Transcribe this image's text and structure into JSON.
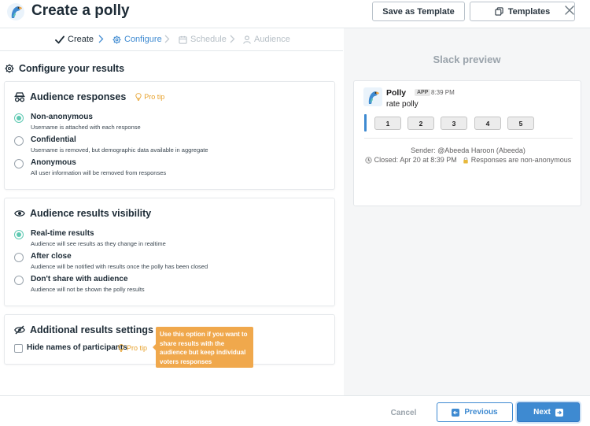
{
  "header": {
    "title": "Create a polly",
    "save_template_label": "Save as Template",
    "templates_label": "Templates"
  },
  "steps": [
    {
      "label": "Create",
      "state": "done"
    },
    {
      "label": "Configure",
      "state": "active"
    },
    {
      "label": "Schedule",
      "state": "pending"
    },
    {
      "label": "Audience",
      "state": "pending"
    }
  ],
  "main": {
    "heading": "Configure your results",
    "audience_responses": {
      "title": "Audience responses",
      "pro_tip": "Pro tip",
      "options": [
        {
          "label": "Non-anonymous",
          "desc": "Username is attached with each response",
          "checked": true
        },
        {
          "label": "Confidential",
          "desc": "Username is removed, but demographic data available in aggregate",
          "checked": false
        },
        {
          "label": "Anonymous",
          "desc": "All user information will be removed from responses",
          "checked": false
        }
      ]
    },
    "results_visibility": {
      "title": "Audience results visibility",
      "options": [
        {
          "label": "Real-time results",
          "desc": "Audience will see results as they change in realtime",
          "checked": true
        },
        {
          "label": "After close",
          "desc": "Audience will be notified with results once the polly has been closed",
          "checked": false
        },
        {
          "label": "Don't share with audience",
          "desc": "Audience will not be shown the polly results",
          "checked": false
        }
      ]
    },
    "additional": {
      "title": "Additional results settings",
      "hide_names_label": "Hide names of participants",
      "pro_tip": "Pro tip",
      "tooltip": "Use this option if you want to share results with the audience but keep individual voters responses anonymous."
    }
  },
  "preview": {
    "title": "Slack preview",
    "bot_name": "Polly",
    "app_badge": "APP",
    "time": "8:39 PM",
    "message": "rate polly",
    "vote_buttons": [
      "1",
      "2",
      "3",
      "4",
      "5"
    ],
    "sender": "Sender: @Abeeda Haroon (Abeeda)",
    "closed": "Closed: Apr 20 at 8:39 PM",
    "responses": "Responses are non-anonymous"
  },
  "footer": {
    "cancel_label": "Cancel",
    "previous_label": "Previous",
    "next_label": "Next"
  },
  "colors": {
    "accent": "#3e8ad1",
    "radio_checked": "#5fc9b2",
    "pro_tip": "#e7a12b",
    "tooltip_bg": "#f0a84c"
  },
  "icons": {
    "logo": "parrot-logo-icon",
    "templates": "copy-icon",
    "close": "close-icon",
    "configure": "gear-icon",
    "schedule": "calendar-icon",
    "audience": "user-icon",
    "audience_responses": "incognito-icon",
    "visibility": "eye-icon",
    "additional": "eye-slash-icon",
    "pro_tip": "lightbulb-icon"
  }
}
